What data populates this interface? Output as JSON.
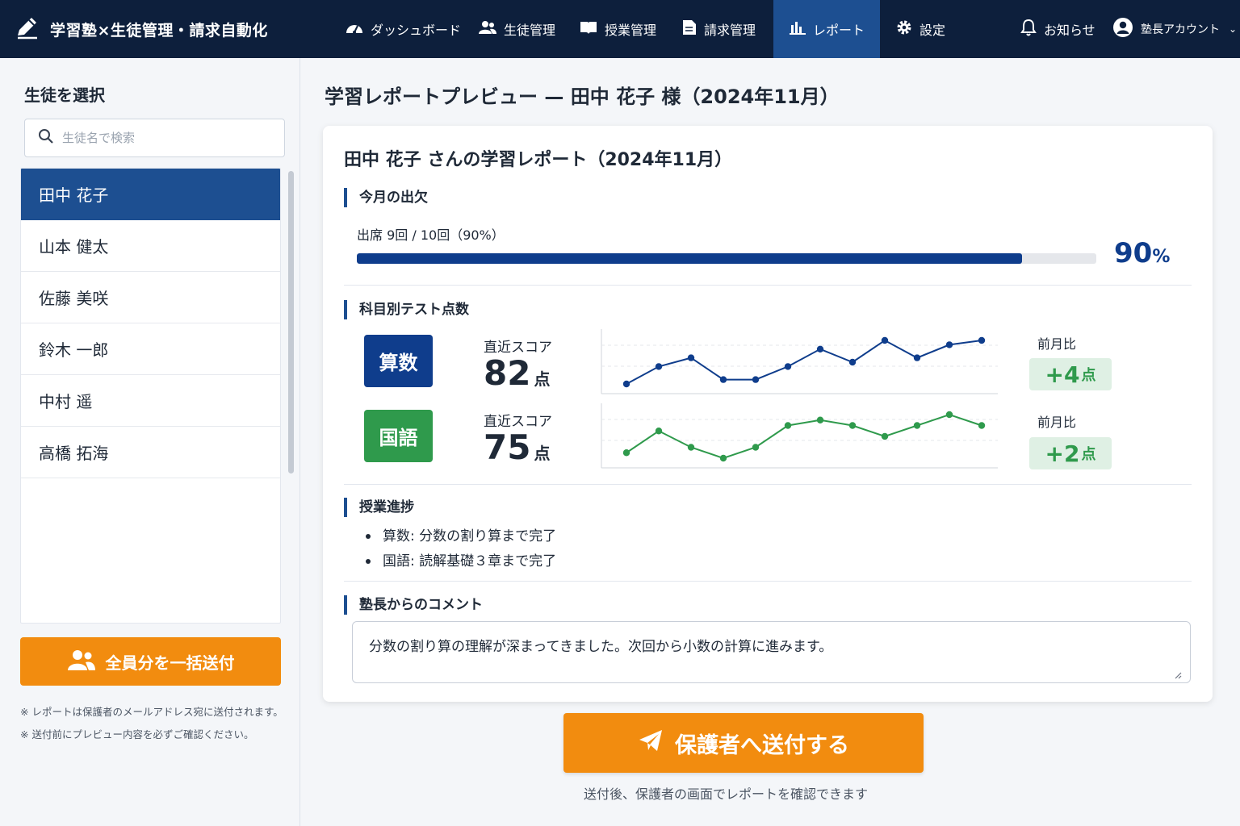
{
  "app": {
    "title": "学習塾×生徒管理・請求自動化"
  },
  "nav": {
    "items": [
      {
        "label": "ダッシュボード",
        "icon": "dashboard-icon"
      },
      {
        "label": "生徒管理",
        "icon": "users-icon"
      },
      {
        "label": "授業管理",
        "icon": "book-icon"
      },
      {
        "label": "請求管理",
        "icon": "invoice-icon"
      },
      {
        "label": "レポート",
        "icon": "chart-icon",
        "active": true
      },
      {
        "label": "設定",
        "icon": "gear-icon"
      }
    ],
    "notifications": "お知らせ",
    "account": "塾長アカウント"
  },
  "sidebar": {
    "title": "生徒を選択",
    "search_placeholder": "生徒名で検索",
    "students": [
      "田中 花子",
      "山本 健太",
      "佐藤 美咲",
      "鈴木 一郎",
      "中村 遥",
      "高橋 拓海"
    ],
    "selected_index": 0,
    "bulk_button": "全員分を一括送付",
    "notes": [
      "※ レポートは保護者のメールアドレス宛に送付されます。",
      "※ 送付前にプレビュー内容を必ずご確認ください。"
    ]
  },
  "main": {
    "page_title": "学習レポートプレビュー — 田中 花子 様（2024年11月）",
    "card_title": "田中 花子 さんの学習レポート（2024年11月）",
    "attendance": {
      "heading": "今月の出欠",
      "label": "出席 9回 / 10回（90%）",
      "percent": 90,
      "percent_text": "90",
      "percent_unit": "%"
    },
    "tests": {
      "heading": "科目別テスト点数",
      "subjects": [
        {
          "name": "算数",
          "color": "#0f3d8c",
          "score_label": "直近スコア",
          "score": "82",
          "unit": "点",
          "compare_label": "前月比",
          "delta": "+4",
          "delta_unit": "点",
          "trend": [
            68,
            72,
            74,
            69,
            69,
            72,
            76,
            73,
            78,
            74,
            77,
            78
          ]
        },
        {
          "name": "国語",
          "color": "#2f9a4c",
          "score_label": "直近スコア",
          "score": "75",
          "unit": "点",
          "compare_label": "前月比",
          "delta": "+2",
          "delta_unit": "点",
          "trend": [
            66,
            70,
            67,
            65,
            67,
            71,
            72,
            71,
            69,
            71,
            73,
            71
          ]
        }
      ]
    },
    "progress": {
      "heading": "授業進捗",
      "items": [
        "算数: 分数の割り算まで完了",
        "国語: 読解基礎３章まで完了"
      ]
    },
    "comment": {
      "heading": "塾長からのコメント",
      "text": "分数の割り算の理解が深まってきました。次回から小数の計算に進みます。"
    },
    "send_button": "保護者へ送付する",
    "send_note": "送付後、保護者の画面でレポートを確認できます"
  },
  "colors": {
    "nav_bg": "#0d1f3c",
    "accent": "#1d4f91",
    "orange": "#f28c0f",
    "green": "#2f9a4c"
  }
}
